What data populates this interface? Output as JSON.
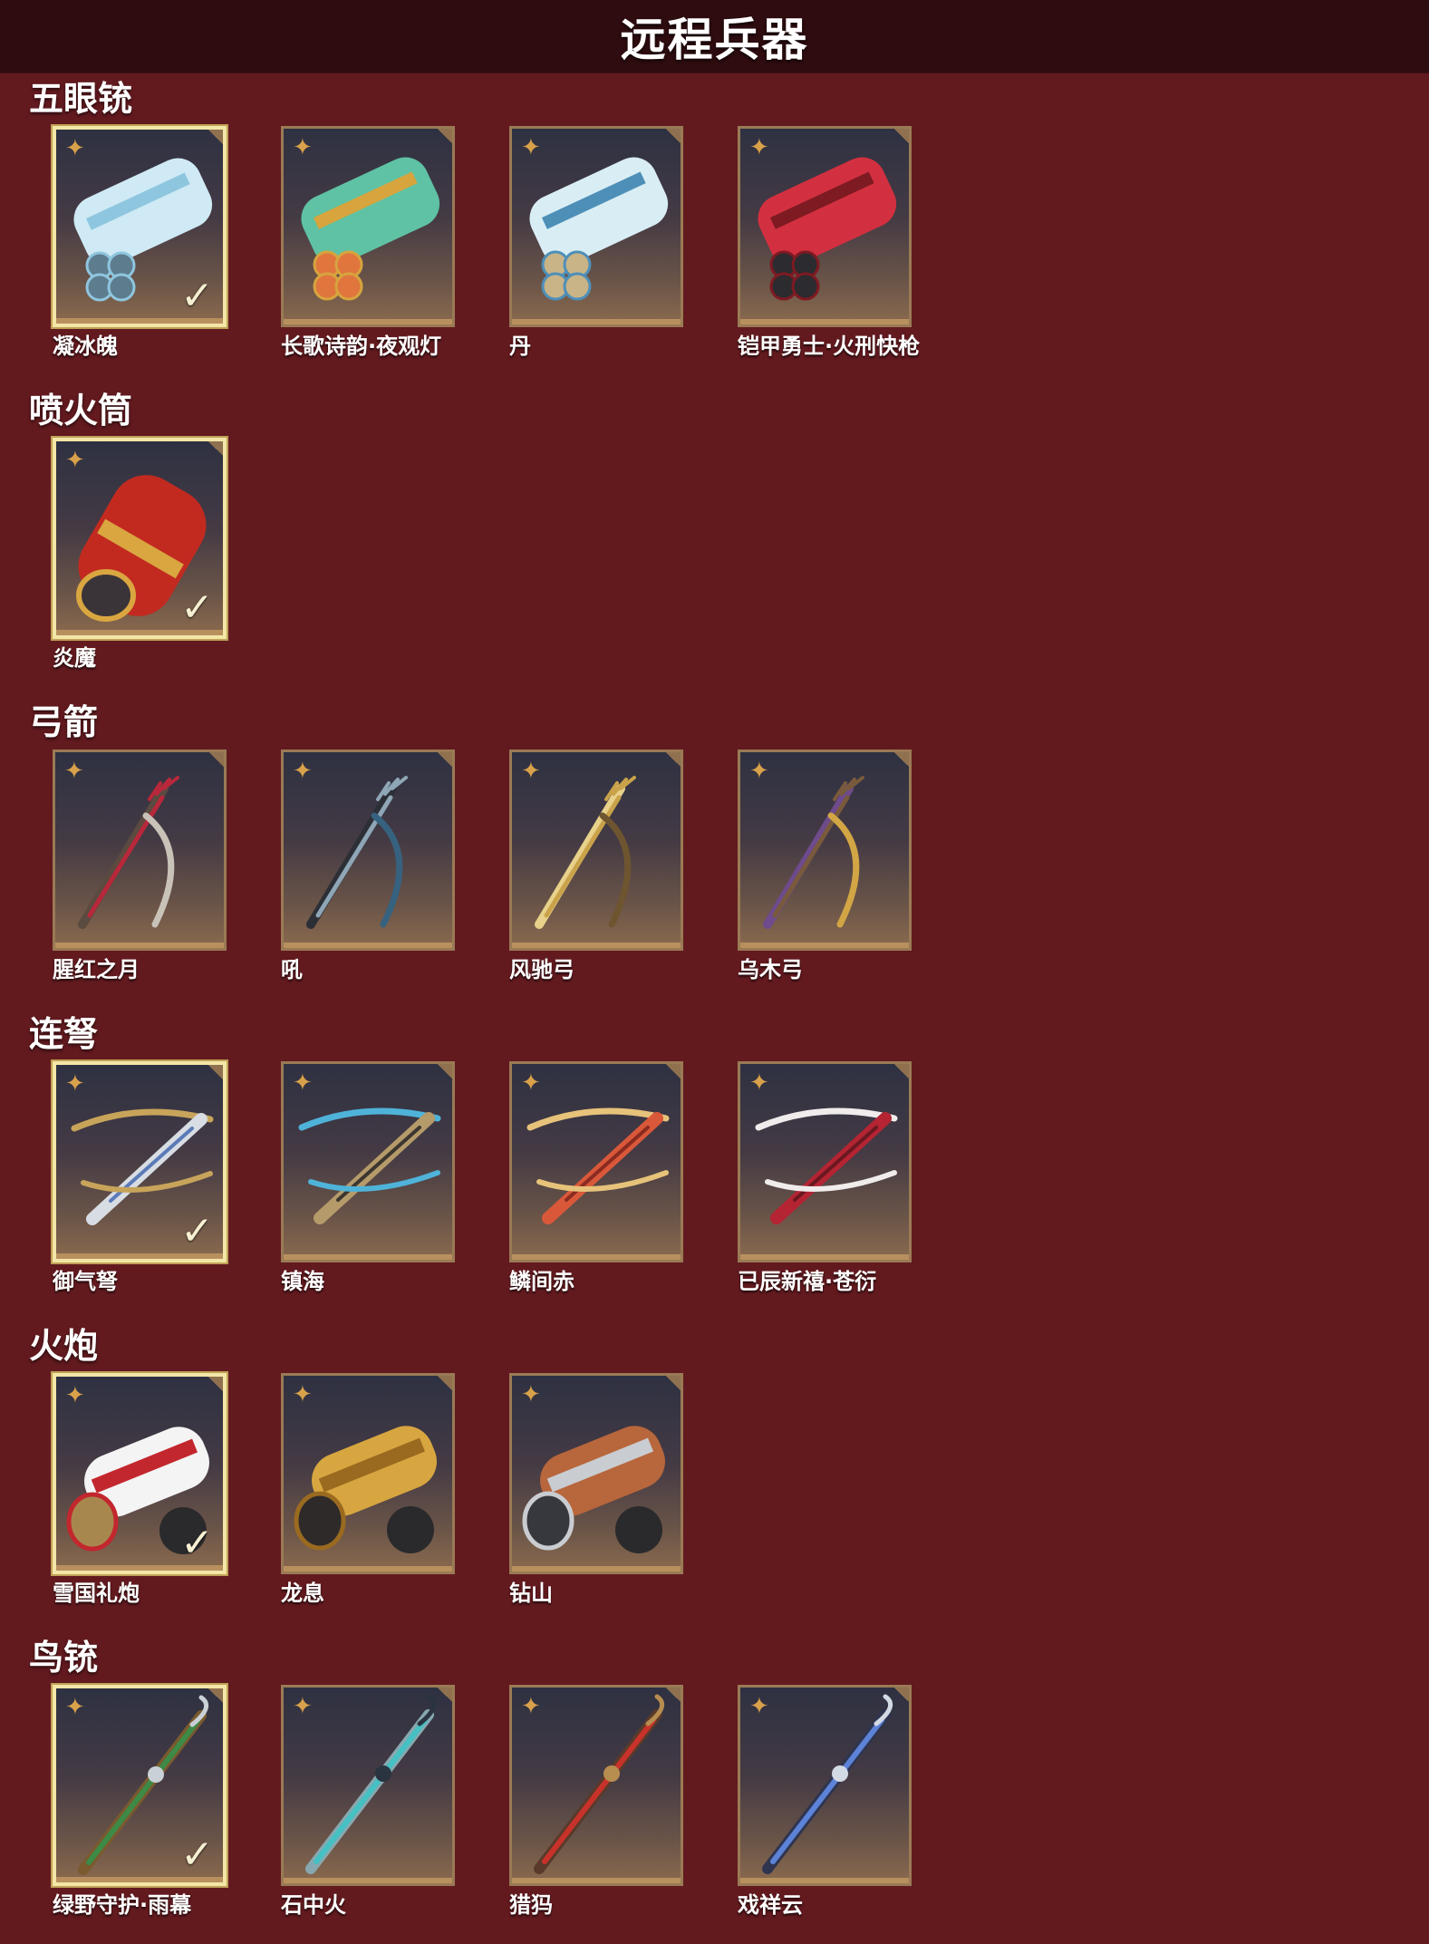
{
  "page_title": "远程兵器",
  "colors": {
    "background": "#621a1f",
    "header": "#2e0c0f",
    "selected_border": "#f3e6a6",
    "card_border": "#9a7a55",
    "star": "#d8a14a"
  },
  "icons": {
    "star": "✦",
    "check": "✓"
  },
  "categories": [
    {
      "title": "五眼铳",
      "items": [
        {
          "name": "凝冰魄",
          "selected": true,
          "theme": "ice-blue"
        },
        {
          "name": "长歌诗韵·夜观灯",
          "selected": false,
          "theme": "jade-gold"
        },
        {
          "name": "丹",
          "selected": false,
          "theme": "porcelain-blue"
        },
        {
          "name": "铠甲勇士·火刑快枪",
          "selected": false,
          "theme": "crimson-mech"
        }
      ]
    },
    {
      "title": "喷火筒",
      "items": [
        {
          "name": "炎魔",
          "selected": true,
          "theme": "red-gold"
        }
      ]
    },
    {
      "title": "弓箭",
      "items": [
        {
          "name": "腥红之月",
          "selected": false,
          "theme": "scarlet"
        },
        {
          "name": "吼",
          "selected": false,
          "theme": "steel-blue"
        },
        {
          "name": "风驰弓",
          "selected": false,
          "theme": "bronze-gold"
        },
        {
          "name": "乌木弓",
          "selected": false,
          "theme": "wood-violet"
        }
      ]
    },
    {
      "title": "连弩",
      "items": [
        {
          "name": "御气弩",
          "selected": true,
          "theme": "silver-gold"
        },
        {
          "name": "镇海",
          "selected": false,
          "theme": "bronze-cyan"
        },
        {
          "name": "鳞间赤",
          "selected": false,
          "theme": "koi-orange"
        },
        {
          "name": "已辰新禧·苍衍",
          "selected": false,
          "theme": "red-white"
        }
      ]
    },
    {
      "title": "火炮",
      "items": [
        {
          "name": "雪国礼炮",
          "selected": true,
          "theme": "snow-red"
        },
        {
          "name": "龙息",
          "selected": false,
          "theme": "dragon-gold"
        },
        {
          "name": "钻山",
          "selected": false,
          "theme": "copper-silver"
        }
      ]
    },
    {
      "title": "鸟铳",
      "items": [
        {
          "name": "绿野守护·雨幕",
          "selected": true,
          "theme": "green-silver"
        },
        {
          "name": "石中火",
          "selected": false,
          "theme": "teal-dark"
        },
        {
          "name": "猎犸",
          "selected": false,
          "theme": "red-bronze"
        },
        {
          "name": "戏祥云",
          "selected": false,
          "theme": "blue-silver"
        }
      ]
    }
  ]
}
